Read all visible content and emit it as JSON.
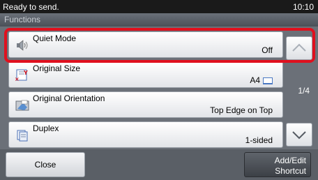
{
  "status": {
    "text": "Ready to send.",
    "time": "10:10"
  },
  "title": "Functions",
  "items": [
    {
      "label": "Quiet Mode",
      "value": "Off",
      "icon": "speaker-icon"
    },
    {
      "label": "Original Size",
      "value": "A4",
      "icon": "original-size-icon"
    },
    {
      "label": "Original Orientation",
      "value": "Top Edge on Top",
      "icon": "orientation-icon"
    },
    {
      "label": "Duplex",
      "value": "1-sided",
      "icon": "duplex-icon"
    }
  ],
  "page_indicator": "1/4",
  "buttons": {
    "close": "Close",
    "add_edit_line1": "Add/Edit",
    "add_edit_line2": "Shortcut"
  },
  "colors": {
    "highlight": "#e0101e",
    "list_background": "#6b7078"
  }
}
